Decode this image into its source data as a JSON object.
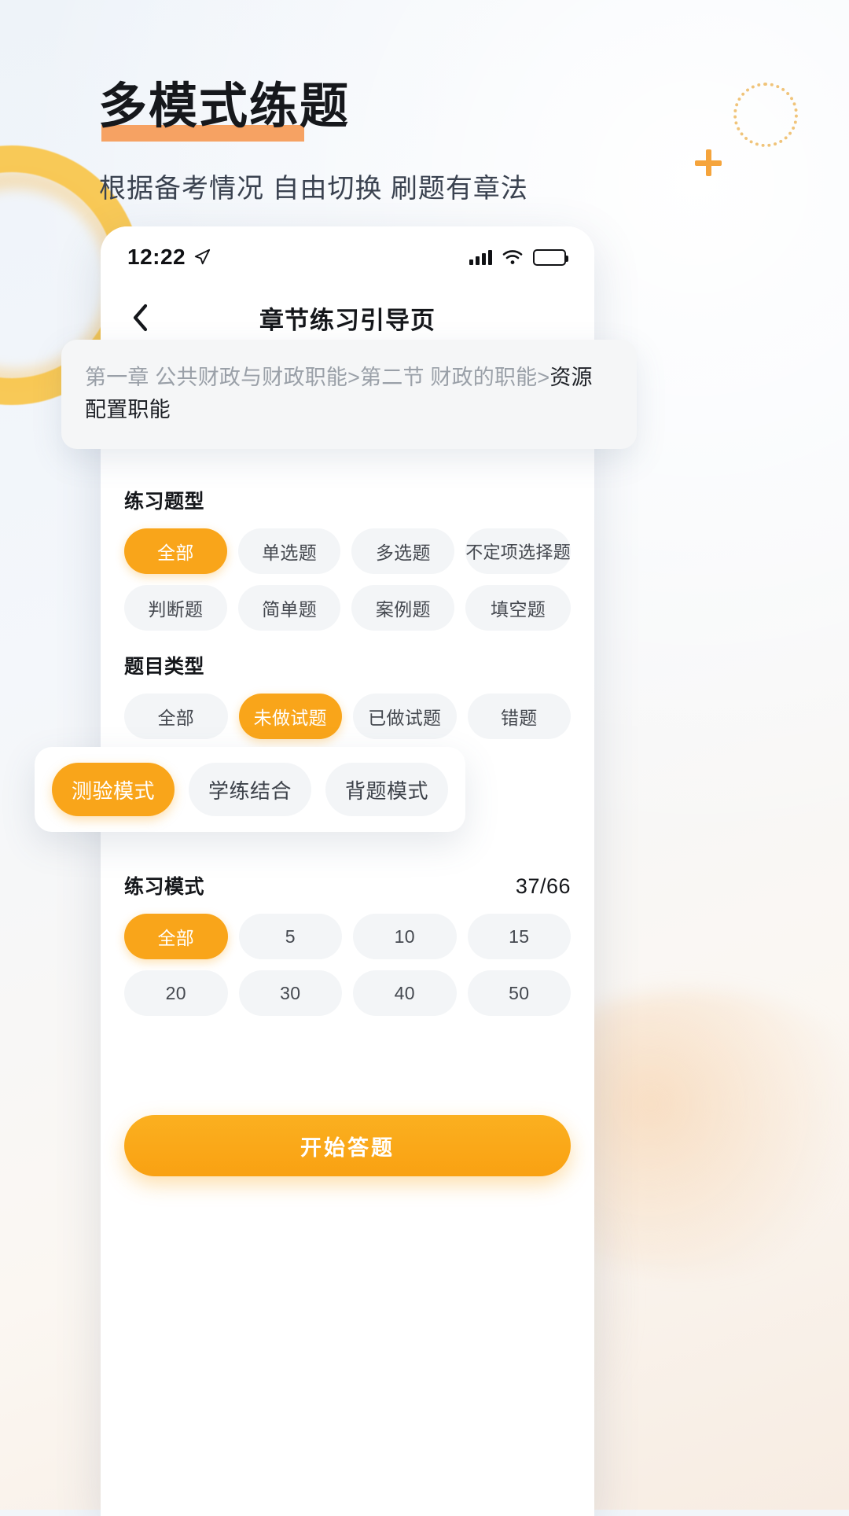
{
  "promo": {
    "title": "多模式练题",
    "subtitle": "根据备考情况 自由切换 刷题有章法",
    "accent_color": "#f9a51a",
    "underline_color": "#f6a263"
  },
  "status_bar": {
    "time": "12:22",
    "location_icon": "location-arrow-icon",
    "signal_icon": "cellular-signal-icon",
    "wifi_icon": "wifi-icon",
    "battery_icon": "battery-full-icon"
  },
  "nav": {
    "back_icon": "chevron-left-icon",
    "title": "章节练习引导页"
  },
  "breadcrumb": {
    "path": "第一章 公共财政与财政职能>第二节 财政的职能>",
    "current": "资源配置职能"
  },
  "question_type": {
    "label": "练习题型",
    "options": [
      {
        "label": "全部",
        "active": true
      },
      {
        "label": "单选题",
        "active": false
      },
      {
        "label": "多选题",
        "active": false
      },
      {
        "label": "不定项选择题",
        "active": false
      },
      {
        "label": "判断题",
        "active": false
      },
      {
        "label": "简单题",
        "active": false
      },
      {
        "label": "案例题",
        "active": false
      },
      {
        "label": "填空题",
        "active": false
      }
    ]
  },
  "item_type": {
    "label": "题目类型",
    "options": [
      {
        "label": "全部",
        "active": false
      },
      {
        "label": "未做试题",
        "active": true
      },
      {
        "label": "已做试题",
        "active": false
      },
      {
        "label": "错题",
        "active": false
      }
    ]
  },
  "mode_card": {
    "options": [
      {
        "label": "测验模式",
        "active": true
      },
      {
        "label": "学练结合",
        "active": false
      },
      {
        "label": "背题模式",
        "active": false
      }
    ]
  },
  "practice_mode": {
    "label": "练习模式",
    "count": "37/66",
    "options": [
      {
        "label": "全部",
        "active": true
      },
      {
        "label": "5",
        "active": false
      },
      {
        "label": "10",
        "active": false
      },
      {
        "label": "15",
        "active": false
      },
      {
        "label": "20",
        "active": false
      },
      {
        "label": "30",
        "active": false
      },
      {
        "label": "40",
        "active": false
      },
      {
        "label": "50",
        "active": false
      }
    ]
  },
  "start_button": {
    "label": "开始答题"
  }
}
